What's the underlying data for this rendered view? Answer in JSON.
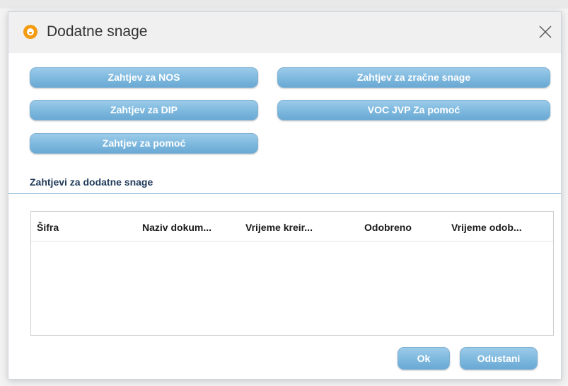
{
  "dialog": {
    "title": "Dodatne snage",
    "icon": "app-logo-icon",
    "accent_color": "#f39c12"
  },
  "request_buttons": {
    "nos": "Zahtjev za NOS",
    "air": "Zahtjev za zračne snage",
    "dip": "Zahtjev za DIP",
    "voc": "VOC JVP Za pomoć",
    "help": "Zahtjev za pomoć"
  },
  "section": {
    "label": "Zahtjevi za dodatne snage"
  },
  "table": {
    "columns": [
      "Šifra",
      "Naziv dokum...",
      "Vrijeme kreir...",
      "Odobreno",
      "Vrijeme odob..."
    ],
    "rows": []
  },
  "footer": {
    "ok_label": "Ok",
    "cancel_label": "Odustani"
  }
}
